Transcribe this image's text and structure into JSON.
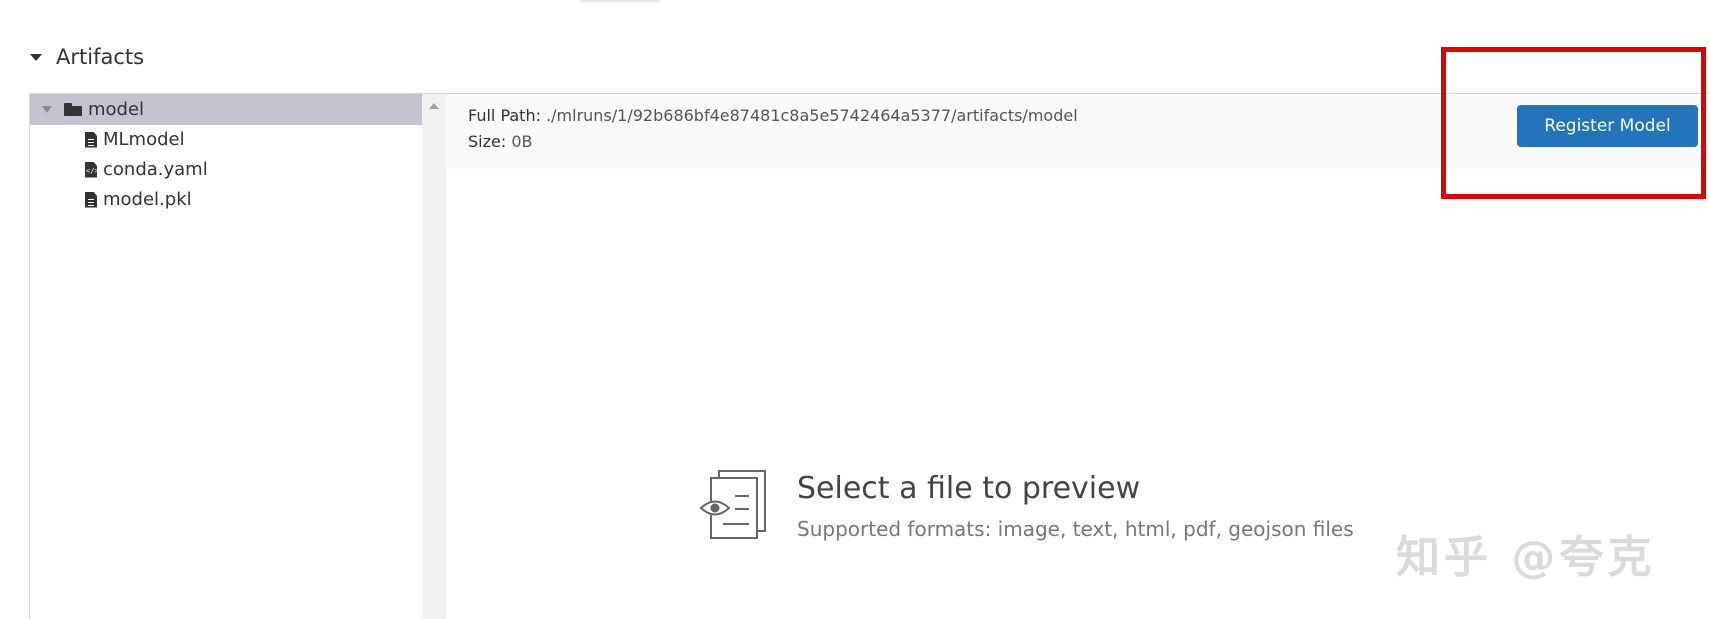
{
  "artifacts_section": {
    "title": "Artifacts"
  },
  "tree": {
    "root": {
      "label": "model",
      "expanded": true,
      "selected": true
    },
    "files": [
      {
        "label": "MLmodel",
        "icon": "file-text-icon"
      },
      {
        "label": "conda.yaml",
        "icon": "file-code-icon"
      },
      {
        "label": "model.pkl",
        "icon": "file-text-icon"
      }
    ]
  },
  "info_bar": {
    "full_path_label": "Full Path:",
    "full_path_value": "./mlruns/1/92b686bf4e87481c8a5e5742464a5377/artifacts/model",
    "size_label": "Size:",
    "size_value": "0B"
  },
  "register_button": {
    "label": "Register Model",
    "color": "#2374bb"
  },
  "empty_state": {
    "title": "Select a file to preview",
    "subtitle": "Supported formats: image, text, html, pdf, geojson files"
  },
  "watermark": {
    "text": "知乎 @夸克"
  },
  "colors": {
    "selected_row": "#c4c3d0",
    "highlight": "#e30000"
  }
}
